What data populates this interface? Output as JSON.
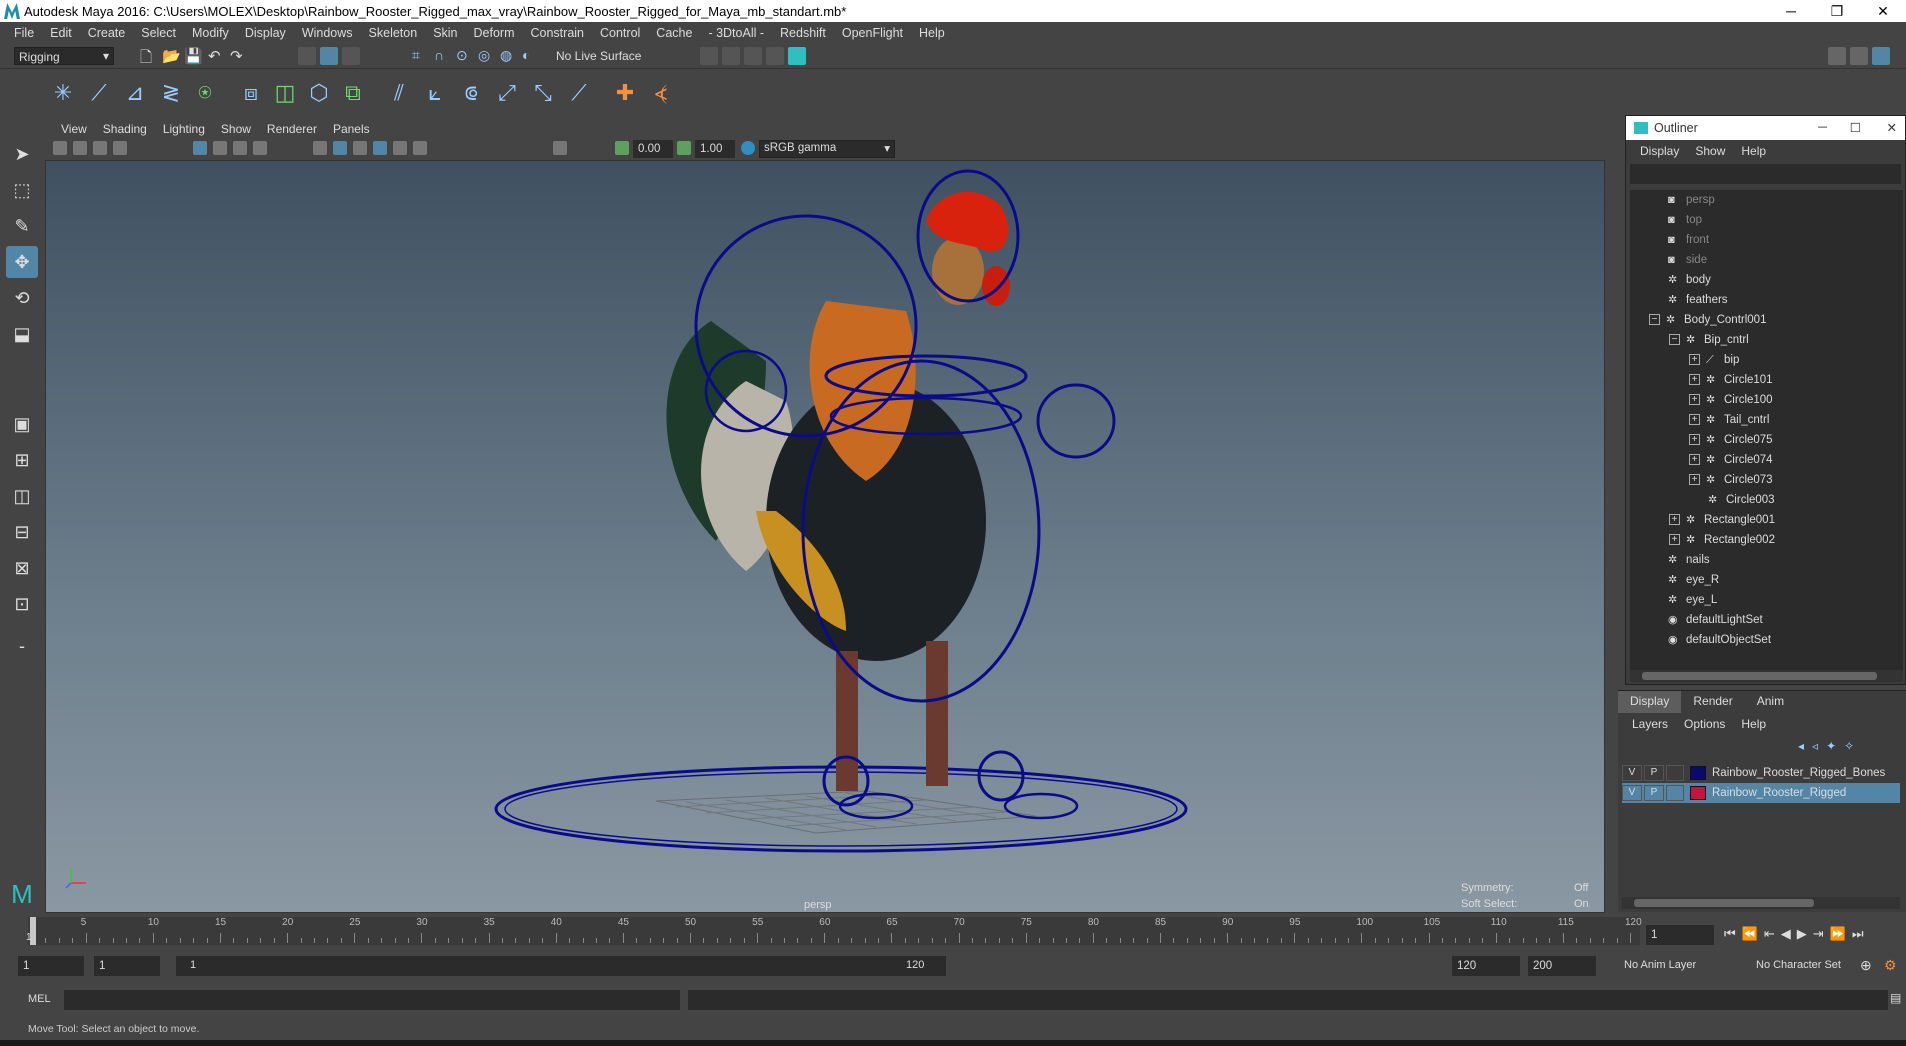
{
  "window": {
    "title": "Autodesk Maya 2016: C:\\Users\\MOLEX\\Desktop\\Rainbow_Rooster_Rigged_max_vray\\Rainbow_Rooster_Rigged_for_Maya_mb_standart.mb*",
    "minimize": "─",
    "restore": "❐",
    "close": "✕"
  },
  "menubar": [
    "File",
    "Edit",
    "Create",
    "Select",
    "Modify",
    "Display",
    "Windows",
    "Skeleton",
    "Skin",
    "Deform",
    "Constrain",
    "Control",
    "Cache",
    "- 3DtoAll -",
    "Redshift",
    "OpenFlight",
    "Help"
  ],
  "statusline": {
    "menuset": "Rigging",
    "live_surface": "No Live Surface"
  },
  "viewport": {
    "menu": [
      "View",
      "Shading",
      "Lighting",
      "Show",
      "Renderer",
      "Panels"
    ],
    "near": "0.00",
    "far": "1.00",
    "color_space": "sRGB gamma",
    "camera_label": "persp",
    "symmetry_label": "Symmetry:",
    "symmetry_value": "Off",
    "softselect_label": "Soft Select:",
    "softselect_value": "On"
  },
  "outliner": {
    "title": "Outliner",
    "menu": [
      "Display",
      "Show",
      "Help"
    ],
    "items": [
      {
        "label": "persp",
        "depth": 0,
        "icon": "camera-icon",
        "dim": true,
        "expand": ""
      },
      {
        "label": "top",
        "depth": 0,
        "icon": "camera-icon",
        "dim": true,
        "expand": ""
      },
      {
        "label": "front",
        "depth": 0,
        "icon": "camera-icon",
        "dim": true,
        "expand": ""
      },
      {
        "label": "side",
        "depth": 0,
        "icon": "camera-icon",
        "dim": true,
        "expand": ""
      },
      {
        "label": "body",
        "depth": 0,
        "icon": "transform-icon",
        "dim": false,
        "expand": ""
      },
      {
        "label": "feathers",
        "depth": 0,
        "icon": "transform-icon",
        "dim": false,
        "expand": ""
      },
      {
        "label": "Body_Contrl001",
        "depth": 0,
        "icon": "transform-icon",
        "dim": false,
        "expand": "−"
      },
      {
        "label": "Bip_cntrl",
        "depth": 1,
        "icon": "transform-icon",
        "dim": false,
        "expand": "−"
      },
      {
        "label": "bip",
        "depth": 2,
        "icon": "joint-icon",
        "dim": false,
        "expand": "+"
      },
      {
        "label": "Circle101",
        "depth": 2,
        "icon": "transform-icon",
        "dim": false,
        "expand": "+"
      },
      {
        "label": "Circle100",
        "depth": 2,
        "icon": "transform-icon",
        "dim": false,
        "expand": "+"
      },
      {
        "label": "Tail_cntrl",
        "depth": 2,
        "icon": "transform-icon",
        "dim": false,
        "expand": "+"
      },
      {
        "label": "Circle075",
        "depth": 2,
        "icon": "transform-icon",
        "dim": false,
        "expand": "+"
      },
      {
        "label": "Circle074",
        "depth": 2,
        "icon": "transform-icon",
        "dim": false,
        "expand": "+"
      },
      {
        "label": "Circle073",
        "depth": 2,
        "icon": "transform-icon",
        "dim": false,
        "expand": "+"
      },
      {
        "label": "Circle003",
        "depth": 2,
        "icon": "transform-icon",
        "dim": false,
        "expand": ""
      },
      {
        "label": "Rectangle001",
        "depth": 1,
        "icon": "transform-icon",
        "dim": false,
        "expand": "+"
      },
      {
        "label": "Rectangle002",
        "depth": 1,
        "icon": "transform-icon",
        "dim": false,
        "expand": "+"
      },
      {
        "label": "nails",
        "depth": 0,
        "icon": "transform-icon",
        "dim": false,
        "expand": ""
      },
      {
        "label": "eye_R",
        "depth": 0,
        "icon": "transform-icon",
        "dim": false,
        "expand": ""
      },
      {
        "label": "eye_L",
        "depth": 0,
        "icon": "transform-icon",
        "dim": false,
        "expand": ""
      },
      {
        "label": "defaultLightSet",
        "depth": 0,
        "icon": "set-icon",
        "dim": false,
        "expand": ""
      },
      {
        "label": "defaultObjectSet",
        "depth": 0,
        "icon": "set-icon",
        "dim": false,
        "expand": ""
      }
    ]
  },
  "layereditor": {
    "tabs": [
      "Display",
      "Render",
      "Anim"
    ],
    "menu": [
      "Layers",
      "Options",
      "Help"
    ],
    "layers": [
      {
        "v": "V",
        "p": "P",
        "name": "Rainbow_Rooster_Rigged_Bones",
        "color": "#0a0a6e",
        "selected": false
      },
      {
        "v": "V",
        "p": "P",
        "name": "Rainbow_Rooster_Rigged",
        "color": "#c8143c",
        "selected": true
      }
    ]
  },
  "timeslider": {
    "ticks": [
      "5",
      "10",
      "15",
      "20",
      "25",
      "30",
      "35",
      "40",
      "45",
      "50",
      "55",
      "60",
      "65",
      "70",
      "75",
      "80",
      "85",
      "90",
      "95",
      "100",
      "105",
      "110",
      "115",
      "120"
    ],
    "current_frame": "1",
    "current_frame_field": "1"
  },
  "rangeslider": {
    "start": "1",
    "playback_start": "1",
    "range_start_label": "1",
    "range_end_label": "120",
    "playback_end": "120",
    "end": "200",
    "anim_layer": "No Anim Layer",
    "character_set": "No Character Set"
  },
  "cmdline": {
    "label": "MEL"
  },
  "helpline": {
    "text": "Move Tool: Select an object to move."
  }
}
